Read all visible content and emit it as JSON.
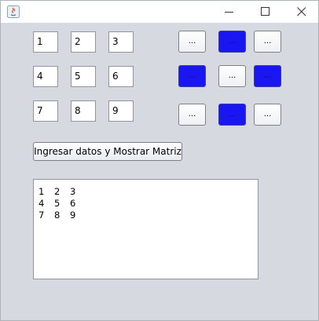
{
  "window": {
    "title": ""
  },
  "titlebar": {
    "minimize_glyph": "—",
    "maximize_glyph": "☐",
    "close_glyph": "✕"
  },
  "matrix_fields": [
    "1",
    "2",
    "3",
    "4",
    "5",
    "6",
    "7",
    "8",
    "9"
  ],
  "matrix_buttons": [
    {
      "label": "...",
      "color": "white"
    },
    {
      "label": "...",
      "color": "blue"
    },
    {
      "label": "...",
      "color": "white"
    },
    {
      "label": "...",
      "color": "blue"
    },
    {
      "label": "...",
      "color": "white"
    },
    {
      "label": "...",
      "color": "blue"
    },
    {
      "label": "...",
      "color": "white"
    },
    {
      "label": "...",
      "color": "blue"
    },
    {
      "label": "...",
      "color": "white"
    }
  ],
  "action_button": {
    "label": "Ingresar datos y Mostrar Matriz"
  },
  "output": {
    "rows": [
      [
        "1",
        "2",
        "3"
      ],
      [
        "4",
        "5",
        "6"
      ],
      [
        "7",
        "8",
        "9"
      ]
    ]
  },
  "colors": {
    "button_blue": "#1a16f2",
    "window_bg": "#d6d9df"
  }
}
